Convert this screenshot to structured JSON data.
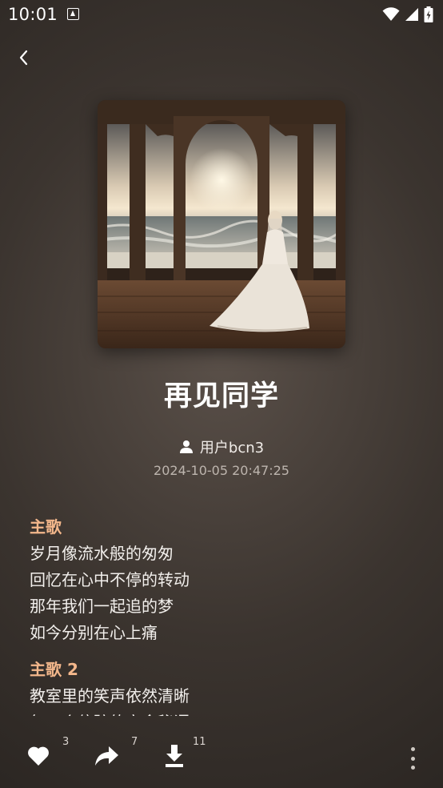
{
  "status_bar": {
    "time": "10:01"
  },
  "song": {
    "title": "再见同学",
    "author": "用户bcn3",
    "date": "2024-10-05 20:47:25"
  },
  "lyrics": [
    {
      "heading": "主歌",
      "lines": [
        "岁月像流水般的匆匆",
        "回忆在心中不停的转动",
        "那年我们一起追的梦",
        "如今分别在心上痛"
      ]
    },
    {
      "heading": "主歌 2",
      "lines": [
        "教室里的笑声依然清晰",
        "每一个停驻的宿舍秘语"
      ]
    }
  ],
  "actions": {
    "like_count": "3",
    "share_count": "7",
    "download_count": "11"
  },
  "icons": {
    "back": "chevron-left-icon",
    "author": "person-icon",
    "like": "heart-icon",
    "share": "share-arrow-icon",
    "download": "download-icon",
    "more": "more-vertical-icon"
  },
  "colors": {
    "section_heading": "#f3b78b",
    "background_center": "#5a5049",
    "background_edge": "#231f1c"
  }
}
